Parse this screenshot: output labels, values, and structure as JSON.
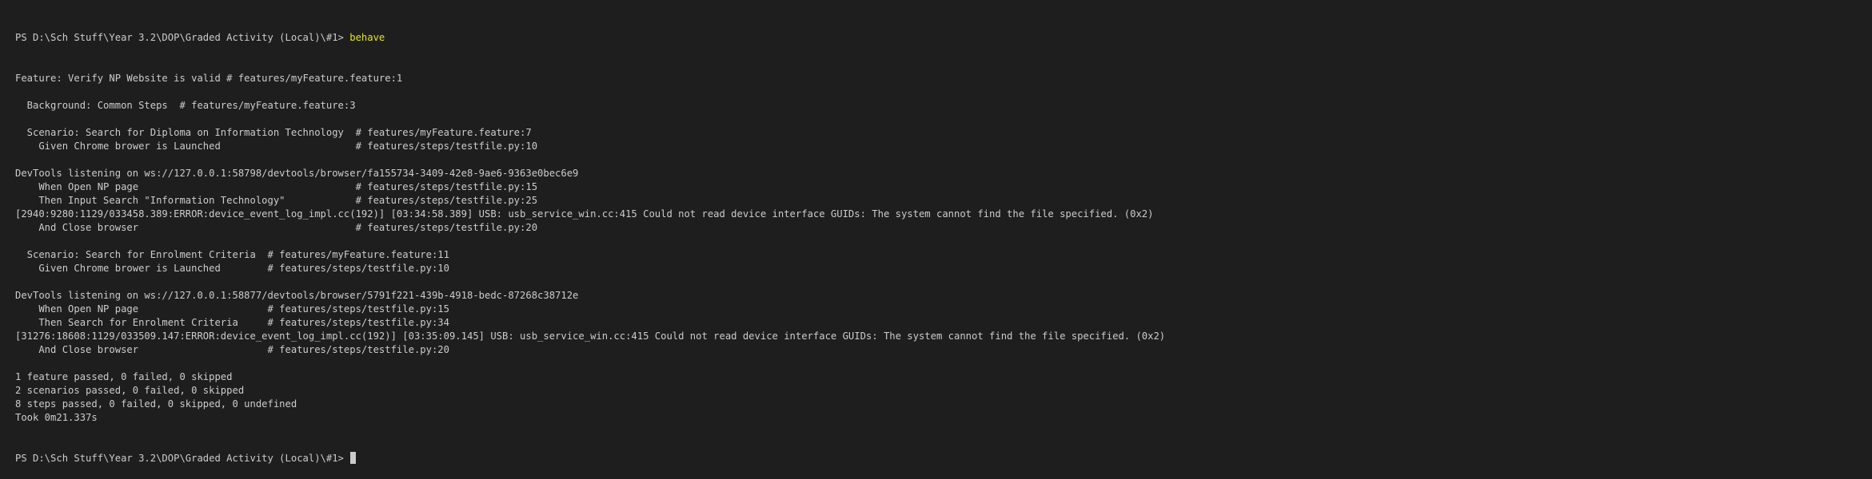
{
  "terminal": {
    "prompt": "PS D:\\Sch Stuff\\Year 3.2\\DOP\\Graded Activity (Local)\\#1> ",
    "command": "behave",
    "output": [
      "Feature: Verify NP Website is valid # features/myFeature.feature:1",
      "",
      "  Background: Common Steps  # features/myFeature.feature:3",
      "",
      "  Scenario: Search for Diploma on Information Technology  # features/myFeature.feature:7",
      "    Given Chrome brower is Launched                       # features/steps/testfile.py:10",
      "",
      "DevTools listening on ws://127.0.0.1:58798/devtools/browser/fa155734-3409-42e8-9ae6-9363e0bec6e9",
      "    When Open NP page                                     # features/steps/testfile.py:15",
      "    Then Input Search \"Information Technology\"            # features/steps/testfile.py:25",
      "[2940:9280:1129/033458.389:ERROR:device_event_log_impl.cc(192)] [03:34:58.389] USB: usb_service_win.cc:415 Could not read device interface GUIDs: The system cannot find the file specified. (0x2)",
      "    And Close browser                                     # features/steps/testfile.py:20",
      "",
      "  Scenario: Search for Enrolment Criteria  # features/myFeature.feature:11",
      "    Given Chrome brower is Launched        # features/steps/testfile.py:10",
      "",
      "DevTools listening on ws://127.0.0.1:58877/devtools/browser/5791f221-439b-4918-bedc-87268c38712e",
      "    When Open NP page                      # features/steps/testfile.py:15",
      "    Then Search for Enrolment Criteria     # features/steps/testfile.py:34",
      "[31276:18608:1129/033509.147:ERROR:device_event_log_impl.cc(192)] [03:35:09.145] USB: usb_service_win.cc:415 Could not read device interface GUIDs: The system cannot find the file specified. (0x2)",
      "    And Close browser                      # features/steps/testfile.py:20",
      "",
      "1 feature passed, 0 failed, 0 skipped",
      "2 scenarios passed, 0 failed, 0 skipped",
      "8 steps passed, 0 failed, 0 skipped, 0 undefined",
      "Took 0m21.337s"
    ],
    "final_prompt": "PS D:\\Sch Stuff\\Year 3.2\\DOP\\Graded Activity (Local)\\#1> "
  },
  "colors": {
    "background": "#1e1e1e",
    "text": "#cccccc",
    "command": "#e5e510",
    "cursor": "#cccccc"
  }
}
